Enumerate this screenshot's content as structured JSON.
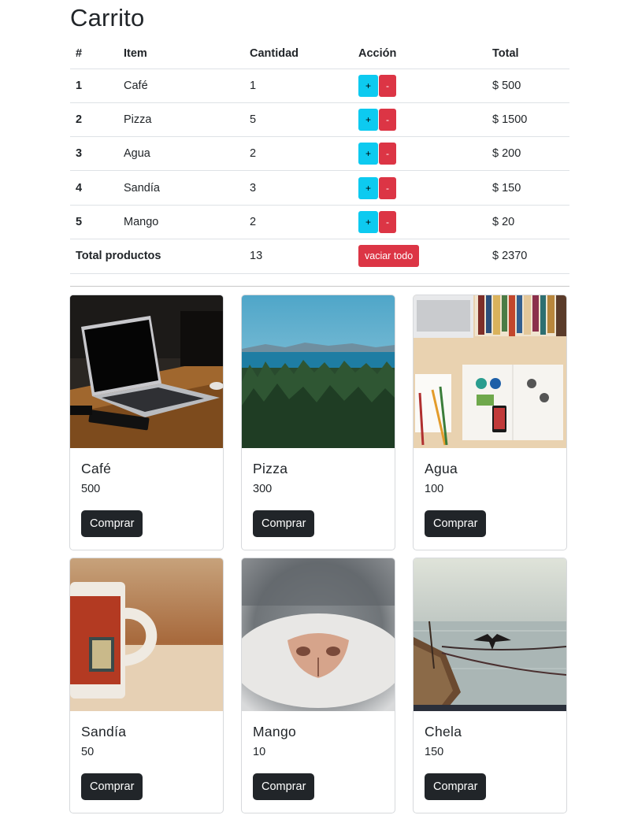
{
  "page": {
    "title": "Carrito"
  },
  "cart": {
    "headers": [
      "#",
      "Item",
      "Cantidad",
      "Acción",
      "Total"
    ],
    "plus_label": "+",
    "minus_label": "-",
    "rows": [
      {
        "num": "1",
        "item": "Café",
        "qty": "1",
        "total": "$ 500"
      },
      {
        "num": "2",
        "item": "Pizza",
        "qty": "5",
        "total": "$ 1500"
      },
      {
        "num": "3",
        "item": "Agua",
        "qty": "2",
        "total": "$ 200"
      },
      {
        "num": "4",
        "item": "Sandía",
        "qty": "3",
        "total": "$ 150"
      },
      {
        "num": "5",
        "item": "Mango",
        "qty": "2",
        "total": "$ 20"
      }
    ],
    "footer": {
      "label": "Total productos",
      "qty": "13",
      "empty_label": "vaciar todo",
      "total": "$ 2370"
    }
  },
  "products": {
    "buy_label": "Comprar",
    "items": [
      {
        "name": "Café",
        "price": "500",
        "image": "laptop-on-wooden-table-photo"
      },
      {
        "name": "Pizza",
        "price": "300",
        "image": "forest-and-sea-landscape-photo"
      },
      {
        "name": "Agua",
        "price": "100",
        "image": "desk-with-books-and-phone-photo"
      },
      {
        "name": "Sandía",
        "price": "50",
        "image": "coffee-mug-photo"
      },
      {
        "name": "Mango",
        "price": "10",
        "image": "cat-nose-closeup-photo"
      },
      {
        "name": "Chela",
        "price": "150",
        "image": "bird-on-boat-at-sea-photo"
      }
    ]
  },
  "colors": {
    "info": "#0dcaf0",
    "danger": "#dc3545",
    "dark": "#212529"
  }
}
